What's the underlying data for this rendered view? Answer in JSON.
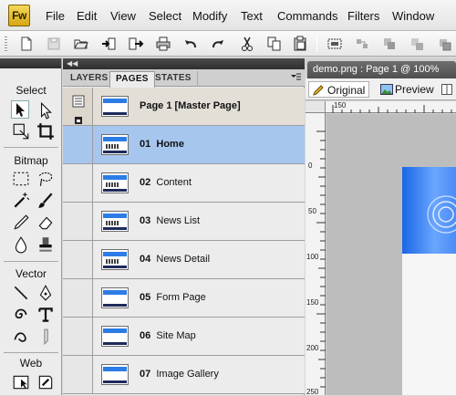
{
  "app": {
    "logo": "Fw",
    "menu": [
      "File",
      "Edit",
      "View",
      "Select",
      "Modify",
      "Text",
      "Commands",
      "Filters",
      "Window"
    ]
  },
  "toolbar": {
    "icons": [
      "new-icon",
      "open-disabled-icon",
      "open-icon",
      "import-icon",
      "export-icon",
      "print-icon",
      "undo-icon",
      "redo-icon",
      "cut-icon",
      "copy-icon",
      "paste-icon",
      "group-icon",
      "ungroup-icon",
      "join-icon",
      "split-icon"
    ]
  },
  "tools": {
    "sections": [
      "Select",
      "Bitmap",
      "Vector",
      "Web"
    ]
  },
  "panel": {
    "tabs": [
      "LAYERS",
      "PAGES",
      "STATES"
    ],
    "active_tab": "PAGES",
    "pages": [
      {
        "num": "",
        "name": "Page 1 [Master Page]",
        "master": true
      },
      {
        "num": "01",
        "name": "Home",
        "selected": true
      },
      {
        "num": "02",
        "name": "Content"
      },
      {
        "num": "03",
        "name": "News List"
      },
      {
        "num": "04",
        "name": "News Detail"
      },
      {
        "num": "05",
        "name": "Form Page"
      },
      {
        "num": "06",
        "name": "Site Map"
      },
      {
        "num": "07",
        "name": "Image Gallery"
      }
    ]
  },
  "document": {
    "tab_title": "demo.png : Page 1 @ 100%",
    "views": [
      "Original",
      "Preview"
    ],
    "active_view": "Original",
    "ruler_top": [
      "150"
    ],
    "ruler_left": [
      "0",
      "50",
      "100",
      "150",
      "200",
      "250"
    ]
  },
  "colors": {
    "selection": "#a6c6ee",
    "banner_blue": "#1a66e8",
    "logo_yellow": "#e8c238"
  }
}
